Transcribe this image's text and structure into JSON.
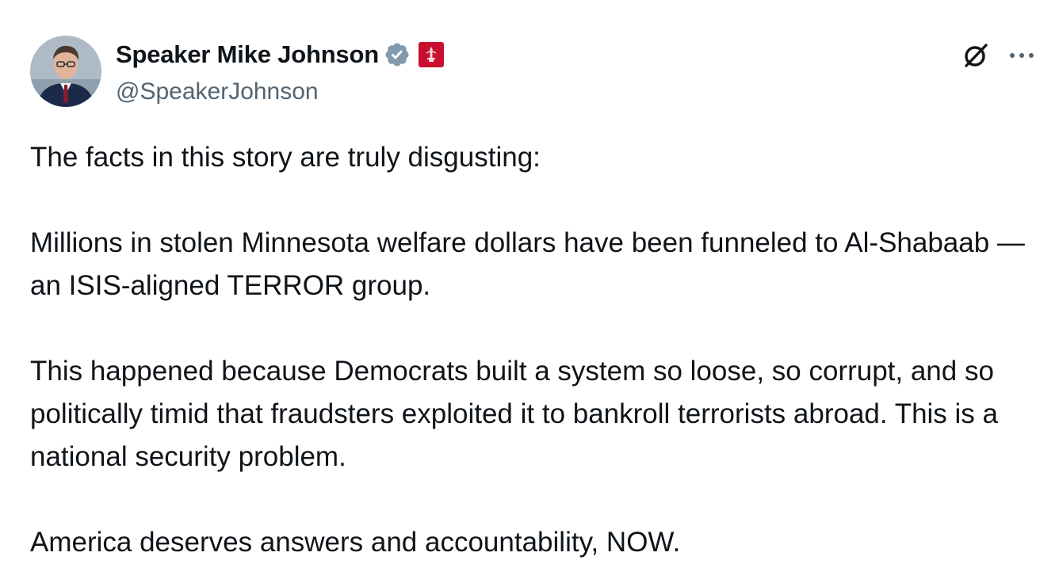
{
  "post": {
    "author": {
      "display_name": "Speaker Mike Johnson",
      "handle": "@SpeakerJohnson",
      "avatar_icon": "avatar-photo",
      "verified_icon": "verified-badge-icon",
      "verified_color": "#829aab",
      "affiliation_icon": "house-affiliation-icon",
      "affiliation_color": "#c8102e"
    },
    "actions": {
      "grok_icon": "grok-icon",
      "more_icon": "more-options-icon"
    },
    "paragraphs": [
      "The facts in this story are truly disgusting:",
      "Millions in stolen Minnesota welfare dollars have been funneled to Al-Shabaab — an ISIS-aligned TERROR group.",
      "This happened because Democrats built a system so loose, so corrupt, and so politically timid that fraudsters exploited it to bankroll terrorists abroad. This is a national security problem.",
      "America deserves answers and accountability, NOW."
    ]
  }
}
